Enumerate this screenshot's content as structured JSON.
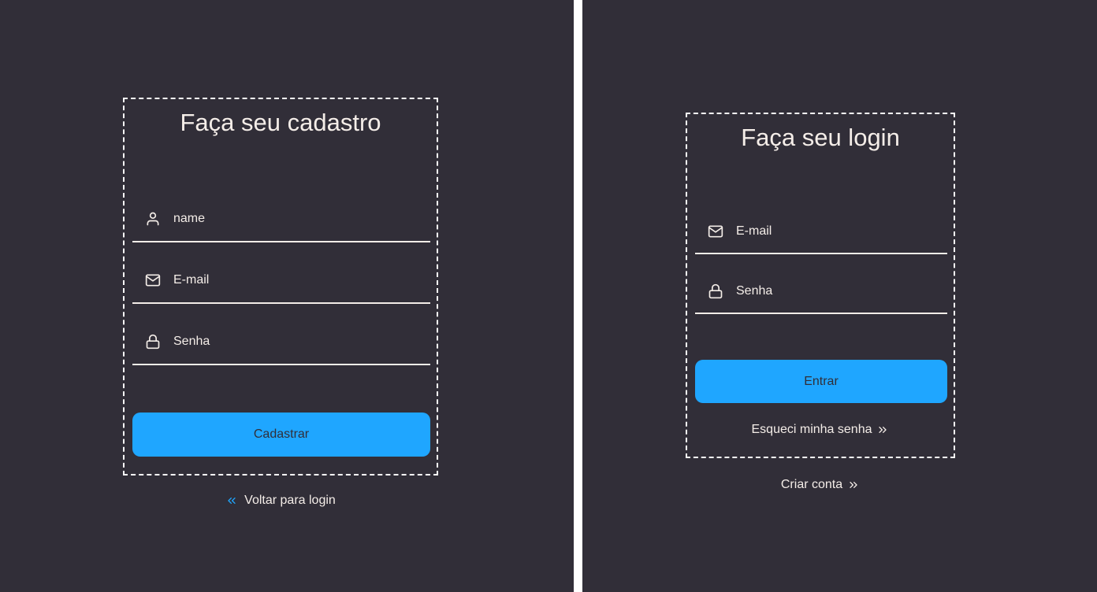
{
  "register": {
    "title": "Faça seu cadastro",
    "name_placeholder": "name",
    "email_placeholder": "E-mail",
    "password_placeholder": "Senha",
    "submit_label": "Cadastrar",
    "back_link": "Voltar para login"
  },
  "login": {
    "title": "Faça seu login",
    "email_placeholder": "E-mail",
    "password_placeholder": "Senha",
    "submit_label": "Entrar",
    "forgot_link": "Esqueci minha senha",
    "create_link": "Criar conta"
  },
  "icons": {
    "user": "user-icon",
    "mail": "mail-icon",
    "lock": "lock-icon",
    "chevrons_left": "chevrons-left-icon",
    "chevrons_right": "chevrons-right-icon"
  },
  "colors": {
    "background": "#312e38",
    "text": "#f4ede8",
    "accent": "#1fa6ff",
    "divider": "#ffffff"
  }
}
